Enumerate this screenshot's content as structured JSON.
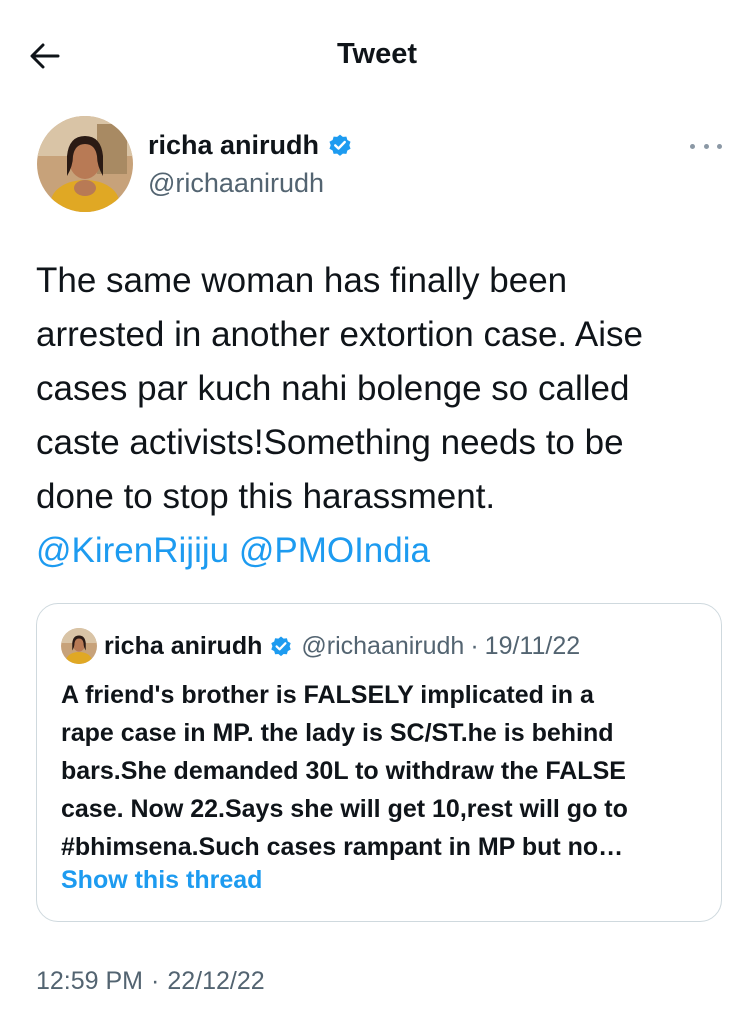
{
  "header": {
    "title": "Tweet",
    "back_icon": "arrow-left-icon"
  },
  "author": {
    "name": "richa anirudh",
    "handle": "@richaanirudh",
    "verified_icon": "verified-badge-icon",
    "more_icon": "more-horizontal-icon"
  },
  "tweet": {
    "lines": [
      "The same woman has finally been",
      "arrested in another extortion case. Aise",
      "cases par kuch nahi bolenge so called",
      "caste activists!Something needs to be",
      "done to stop this harassment."
    ],
    "mentions": [
      "@KirenRijiju",
      "@PMOIndia"
    ]
  },
  "quote": {
    "name": "richa anirudh",
    "handle": "@richaanirudh",
    "separator": "·",
    "date": "19/11/22",
    "lines": [
      "A friend's brother is FALSELY implicated in a",
      "rape case in MP. the lady is SC/ST.he is behind",
      "bars.She demanded 30L to withdraw the FALSE",
      "case. Now 22.Says she will get 10,rest will go to",
      "#bhimsena.Such cases rampant in MP but no…"
    ],
    "show_thread": "Show this thread"
  },
  "meta": {
    "time": "12:59 PM",
    "separator": "·",
    "date": "22/12/22"
  },
  "colors": {
    "text": "#0f1419",
    "secondary": "#536471",
    "link": "#1d9bf0",
    "border": "#cfd9de"
  }
}
